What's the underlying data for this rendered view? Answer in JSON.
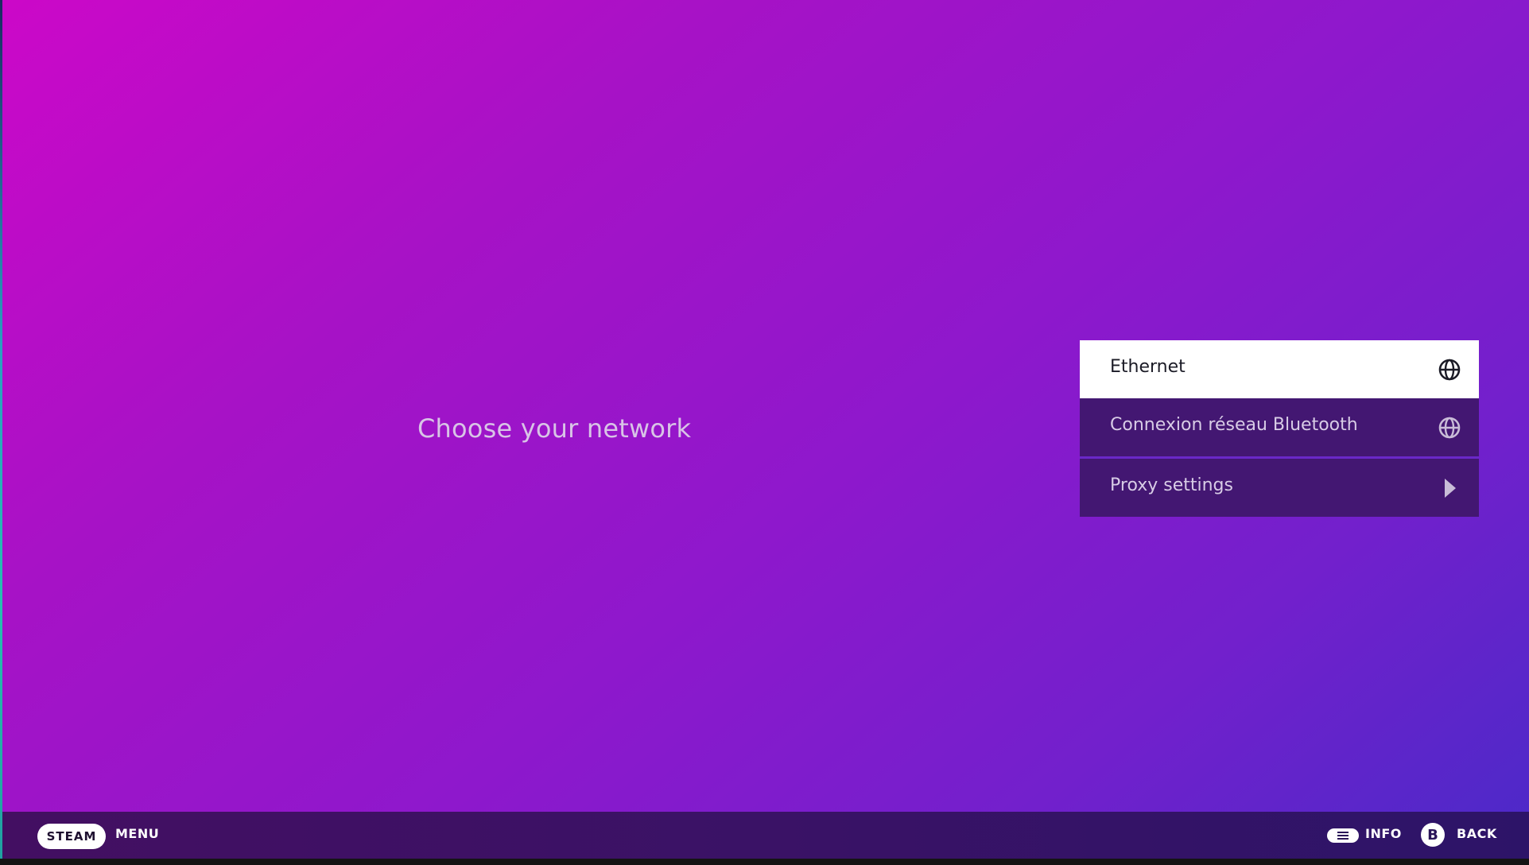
{
  "page": {
    "title": "Choose your network"
  },
  "networks": [
    {
      "label": "Ethernet",
      "icon": "globe-icon",
      "selected": true
    },
    {
      "label": "Connexion réseau Bluetooth",
      "icon": "globe-icon",
      "selected": false
    },
    {
      "label": "Proxy settings",
      "icon": "chevron-right-icon",
      "selected": false
    }
  ],
  "footer": {
    "steam_label": "STEAM",
    "menu_label": "MENU",
    "info_label": "INFO",
    "back_button_glyph": "B",
    "back_label": "BACK"
  },
  "colors": {
    "gradient_start": "#cc08c8",
    "gradient_end": "#4a2ac8",
    "item_background": "#431772",
    "item_selected_background": "#ffffff",
    "footer_background": "#3a1266"
  }
}
